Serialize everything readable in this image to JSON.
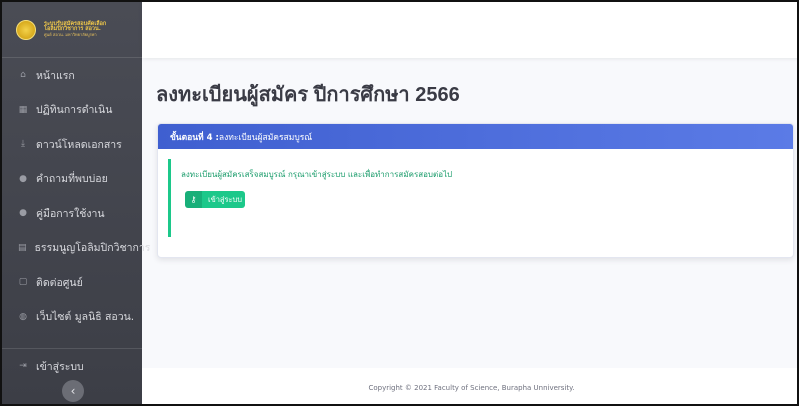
{
  "brand": {
    "line1": "ระบบรับสมัครสอบคัดเลือก",
    "line2": "โอลิมปิกวิชาการ สอวน.",
    "line3": "ศูนย์ สอวน. มหาวิทยาลัยบูรพา"
  },
  "sidebar": {
    "items": [
      {
        "label": "หน้าแรก",
        "icon": "home-icon"
      },
      {
        "label": "ปฏิทินการดำเนิน",
        "icon": "calendar-icon"
      },
      {
        "label": "ดาวน์โหลดเอกสาร",
        "icon": "download-icon"
      },
      {
        "label": "คำถามที่พบบ่อย",
        "icon": "question-icon"
      },
      {
        "label": "คู่มือการใช้งาน",
        "icon": "manual-icon"
      },
      {
        "label": "ธรรมนูญโอลิมปิกวิชาการ",
        "icon": "book-icon"
      },
      {
        "label": "ติดต่อศูนย์",
        "icon": "contact-icon"
      },
      {
        "label": "เว็บไซต์ มูลนิธิ สอวน.",
        "icon": "globe-icon"
      }
    ],
    "login_label": "เข้าสู่ระบบ",
    "collapse_symbol": "‹"
  },
  "main": {
    "title": "ลงทะเบียนผู้สมัคร ปีการศึกษา 2566",
    "card": {
      "step_label": "ขั้นตอนที่ 4 :",
      "header_text": " ลงทะเบียนผู้สมัครสมบูรณ์",
      "message": "ลงทะเบียนผู้สมัครเสร็จสมบูรณ์ กรุณาเข้าสู่ระบบ และเพื่อทำการสมัครสอบต่อไป",
      "button_label": "เข้าสู่ระบบ"
    }
  },
  "footer": {
    "copyright": "Copyright © 2021 Faculty of Science, Burapha Unniversity."
  },
  "colors": {
    "sidebar_bg": "#44464e",
    "accent_blue": "#4e6fde",
    "success_green": "#1cc88a"
  }
}
